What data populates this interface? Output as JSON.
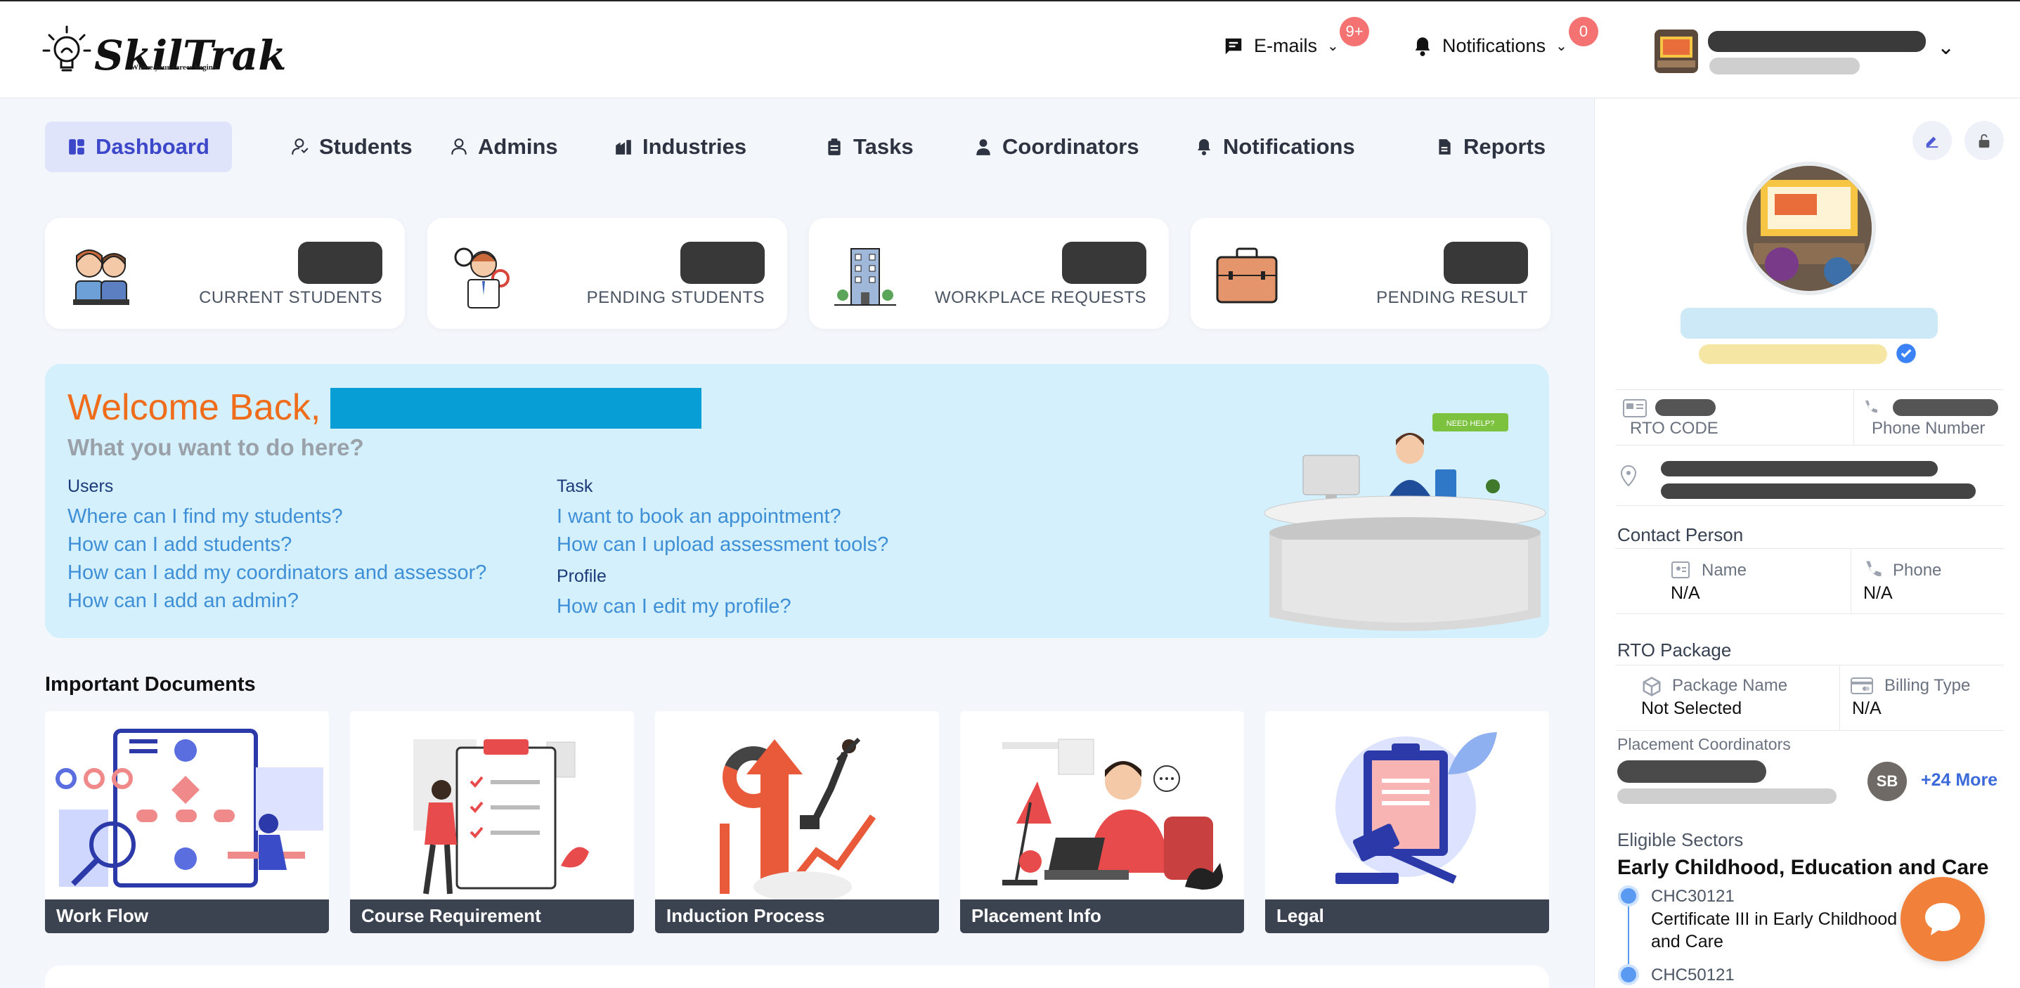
{
  "brand": {
    "name": "SkilTrak",
    "tagline": "Where your career begins"
  },
  "header": {
    "emails_label": "E-mails",
    "emails_badge": "9+",
    "notifications_label": "Notifications",
    "notifications_badge": "0"
  },
  "nav": {
    "items": [
      {
        "label": "Dashboard",
        "icon": "dashboard-icon",
        "active": true
      },
      {
        "label": "Students",
        "icon": "students-icon"
      },
      {
        "label": "Admins",
        "icon": "admins-icon"
      },
      {
        "label": "Industries",
        "icon": "industries-icon"
      },
      {
        "label": "Tasks",
        "icon": "tasks-icon"
      },
      {
        "label": "Coordinators",
        "icon": "coordinators-icon"
      },
      {
        "label": "Notifications",
        "icon": "bell-icon"
      },
      {
        "label": "Reports",
        "icon": "reports-icon"
      }
    ]
  },
  "stats": [
    {
      "label": "CURRENT STUDENTS",
      "icon": "students-illustration"
    },
    {
      "label": "PENDING STUDENTS",
      "icon": "pending-student-illustration"
    },
    {
      "label": "WORKPLACE REQUESTS",
      "icon": "building-illustration"
    },
    {
      "label": "PENDING RESULT",
      "icon": "briefcase-illustration"
    }
  ],
  "welcome": {
    "greeting": "Welcome Back,",
    "subtitle": "What you want to do here?",
    "users_heading": "Users",
    "users_links": [
      "Where can I find my students?",
      "How can I add students?",
      "How can I add my coordinators and assessor?",
      "How can I add an admin?"
    ],
    "task_heading": "Task",
    "task_links": [
      "I want to book an appointment?",
      "How can I upload assessment tools?"
    ],
    "profile_heading": "Profile",
    "profile_links": [
      "How can I edit my profile?"
    ],
    "need_help": "NEED HELP?"
  },
  "documents": {
    "title": "Important Documents",
    "items": [
      "Work Flow",
      "Course Requirement",
      "Induction Process",
      "Placement Info",
      "Legal"
    ]
  },
  "profile_panel": {
    "rto_code_label": "RTO CODE",
    "phone_number_label": "Phone Number",
    "contact_person_title": "Contact Person",
    "name_label": "Name",
    "name_value": "N/A",
    "phone_label": "Phone",
    "phone_value": "N/A",
    "rto_package_title": "RTO Package",
    "package_name_label": "Package Name",
    "package_name_value": "Not Selected",
    "billing_type_label": "Billing Type",
    "billing_type_value": "N/A",
    "placement_coordinators_title": "Placement Coordinators",
    "coordinator_initials": "SB",
    "more_label": "+24 More",
    "eligible_sectors_title": "Eligible Sectors",
    "sector_name": "Early Childhood, Education and Care",
    "courses": [
      {
        "code": "CHC30121",
        "name": "Certificate III in Early Childhood Education and Care"
      },
      {
        "code": "CHC50121",
        "name": ""
      }
    ]
  },
  "colors": {
    "accent": "#3c47c9",
    "welcome_bg": "#d3f0fc",
    "greeting": "#ef6c1a",
    "link": "#3f8fd7",
    "chat": "#f1803a"
  }
}
